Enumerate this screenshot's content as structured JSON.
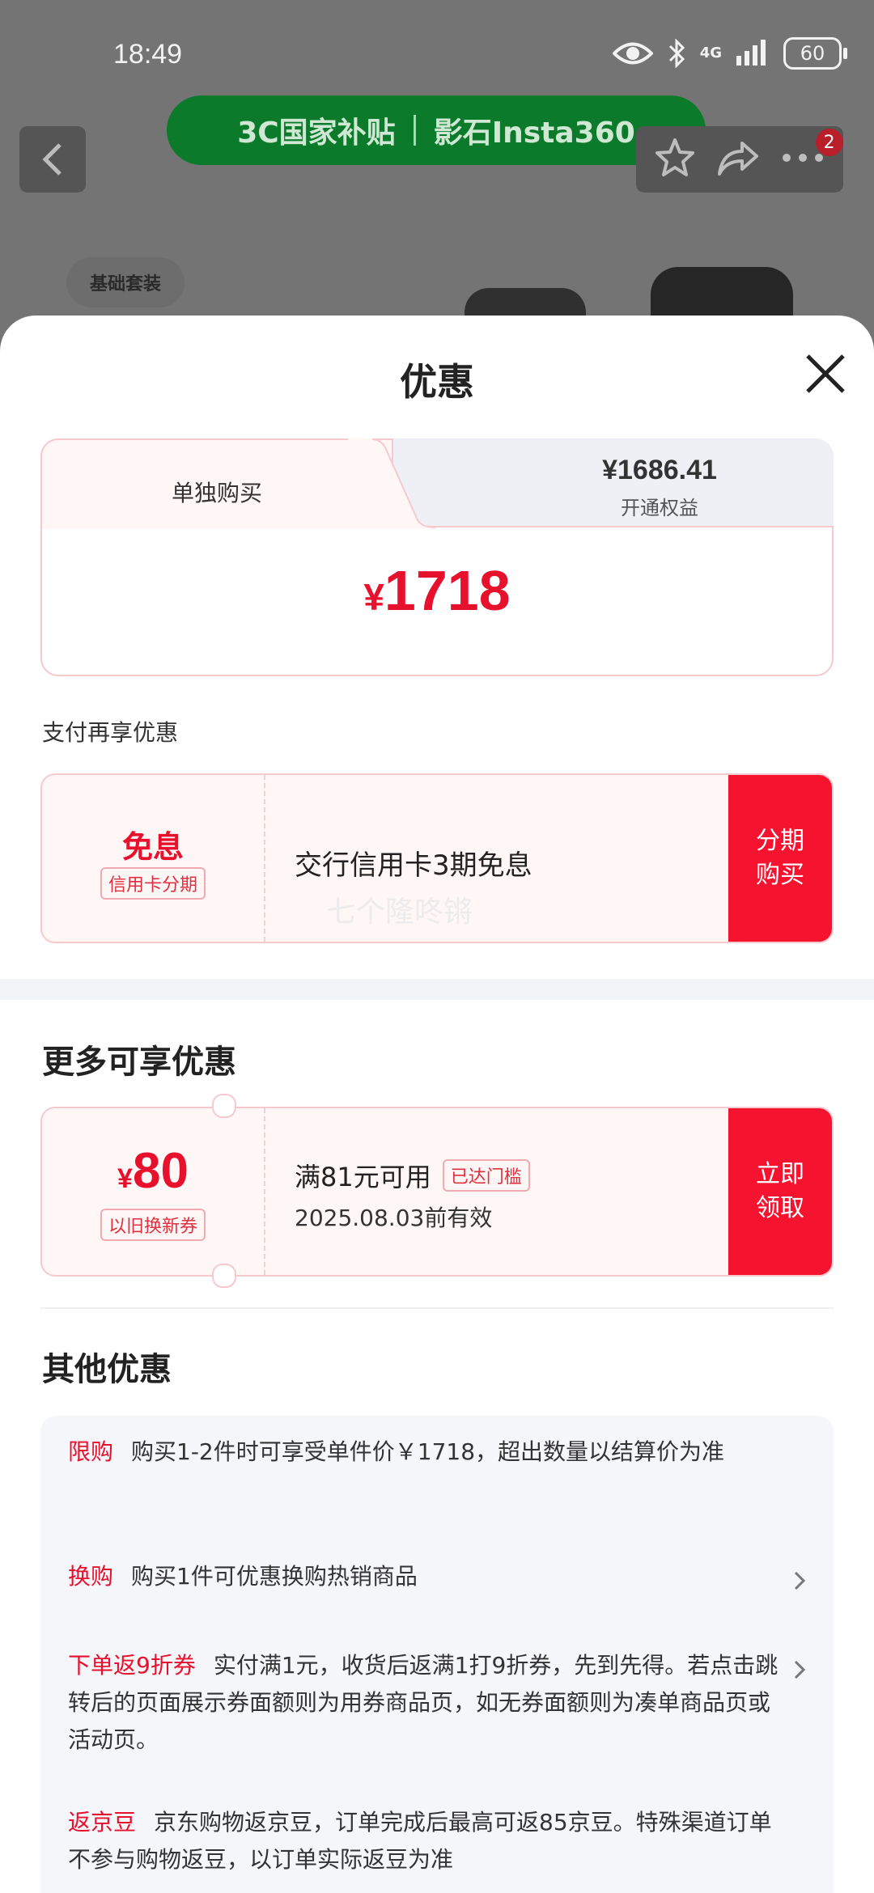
{
  "status_bar": {
    "time": "18:49",
    "network": "4G",
    "battery": "60"
  },
  "page": {
    "banner_left": "3C国家补贴",
    "banner_right": "影石Insta360",
    "package_tag": "基础套装",
    "notification_count": "2"
  },
  "sheet": {
    "title": "优惠",
    "tabs": {
      "active_label": "单独购买",
      "member_price": "¥1686.41",
      "member_sub": "开通权益"
    },
    "price": {
      "currency": "¥",
      "amount": "1718"
    },
    "pay_more_label": "支付再享优惠",
    "installment": {
      "title": "免息",
      "tag": "信用卡分期",
      "text": "交行信用卡3期免息",
      "action_line1": "分期",
      "action_line2": "购买"
    },
    "watermark": "七个隆咚锵",
    "more_title": "更多可享优惠",
    "coupon": {
      "currency": "¥",
      "amount": "80",
      "tag": "以旧换新券",
      "condition": "满81元可用",
      "condition_tag": "已达门槛",
      "valid": "2025.08.03前有效",
      "action_line1": "立即",
      "action_line2": "领取"
    },
    "other_title": "其他优惠",
    "promotions": [
      {
        "type": "限购",
        "text": "购买1-2件时可享受单件价￥1718，超出数量以结算价为准"
      },
      {
        "type": "换购",
        "text": "购买1件可优惠换购热销商品"
      },
      {
        "type": "下单返9折券",
        "text": "实付满1元，收货后返满1打9折券，先到先得。若点击跳转后的页面展示券面额则为用券商品页，如无券面额则为凑单商品页或活动页。"
      },
      {
        "type": "返京豆",
        "text": "京东购物返京豆，订单完成后最高可返85京豆。特殊渠道订单不参与购物返豆，以订单实际返豆为准"
      }
    ]
  }
}
